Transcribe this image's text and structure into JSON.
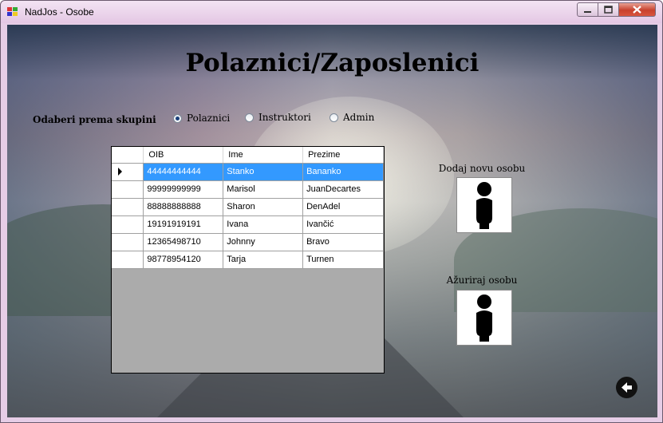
{
  "window": {
    "title": "NadJos - Osobe"
  },
  "heading": "Polaznici/Zaposlenici",
  "filter": {
    "label": "Odaberi prema skupini",
    "options": [
      {
        "label": "Polaznici",
        "selected": true
      },
      {
        "label": "Instruktori",
        "selected": false
      },
      {
        "label": "Admin",
        "selected": false
      }
    ]
  },
  "grid": {
    "columns": [
      "OIB",
      "Ime",
      "Prezime"
    ],
    "rows": [
      {
        "oib": "44444444444",
        "ime": "Stanko",
        "prezime": "Bananko",
        "selected": true
      },
      {
        "oib": "99999999999",
        "ime": "Marisol",
        "prezime": "JuanDecartes"
      },
      {
        "oib": "88888888888",
        "ime": "Sharon",
        "prezime": "DenAdel"
      },
      {
        "oib": "19191919191",
        "ime": "Ivana",
        "prezime": "Ivančić"
      },
      {
        "oib": "12365498710",
        "ime": "Johnny",
        "prezime": "Bravo"
      },
      {
        "oib": "98778954120",
        "ime": "Tarja",
        "prezime": "Turnen"
      }
    ]
  },
  "actions": {
    "add_label": "Dodaj novu osobu",
    "update_label": "Ažuriraj osobu"
  },
  "icons": {
    "add": "person-icon",
    "update": "person-icon",
    "back": "back-arrow-icon"
  },
  "colors": {
    "selection": "#3399ff",
    "grid_empty": "#ababab"
  }
}
